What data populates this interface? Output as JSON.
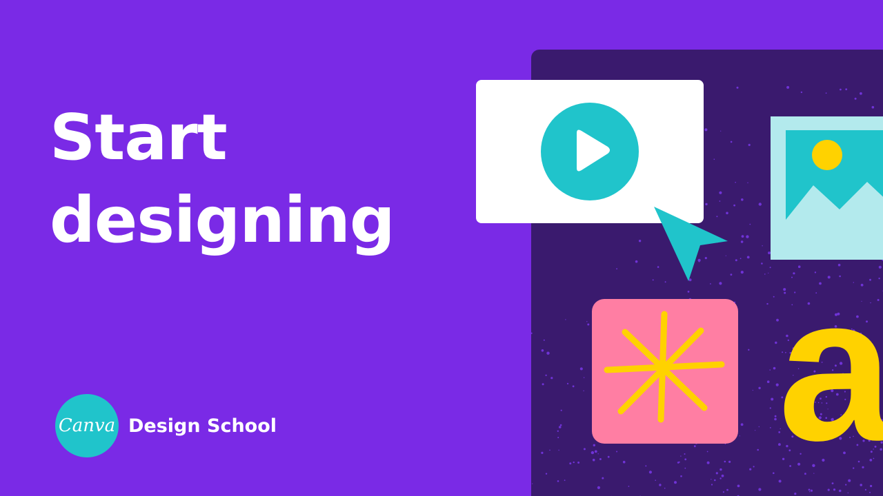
{
  "headline": {
    "line1": "Start",
    "line2": "designing"
  },
  "brand": {
    "logo_text": "Canva",
    "label": "Design School"
  },
  "illustration": {
    "letter": "a",
    "icons": [
      "play-icon",
      "cursor-icon",
      "image-icon",
      "sparkle-icon"
    ]
  },
  "colors": {
    "background": "#7a2ae6",
    "panel": "#3a1a6e",
    "teal": "#20c4cb",
    "yellow": "#ffd200",
    "pink": "#ff7ea3",
    "light_cyan": "#b3eaed"
  }
}
